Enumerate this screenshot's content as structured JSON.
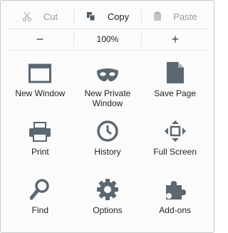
{
  "edit": {
    "cut": {
      "label": "Cut",
      "icon": "scissors-icon",
      "enabled": false
    },
    "copy": {
      "label": "Copy",
      "icon": "copy-icon",
      "enabled": true
    },
    "paste": {
      "label": "Paste",
      "icon": "clipboard-icon",
      "enabled": false
    }
  },
  "zoom": {
    "minus": "−",
    "level": "100%",
    "plus": "+"
  },
  "items": [
    {
      "label": "New Window",
      "icon": "window-icon"
    },
    {
      "label": "New Private Window",
      "icon": "mask-icon"
    },
    {
      "label": "Save Page",
      "icon": "document-icon"
    },
    {
      "label": "Print",
      "icon": "printer-icon"
    },
    {
      "label": "History",
      "icon": "clock-icon"
    },
    {
      "label": "Full Screen",
      "icon": "fullscreen-icon"
    },
    {
      "label": "Find",
      "icon": "magnifier-icon"
    },
    {
      "label": "Options",
      "icon": "gear-icon"
    },
    {
      "label": "Add-ons",
      "icon": "puzzle-icon"
    }
  ],
  "colors": {
    "icon": "#5b6771",
    "disabled": "#9a9a9a",
    "border": "#c9c9c9"
  }
}
